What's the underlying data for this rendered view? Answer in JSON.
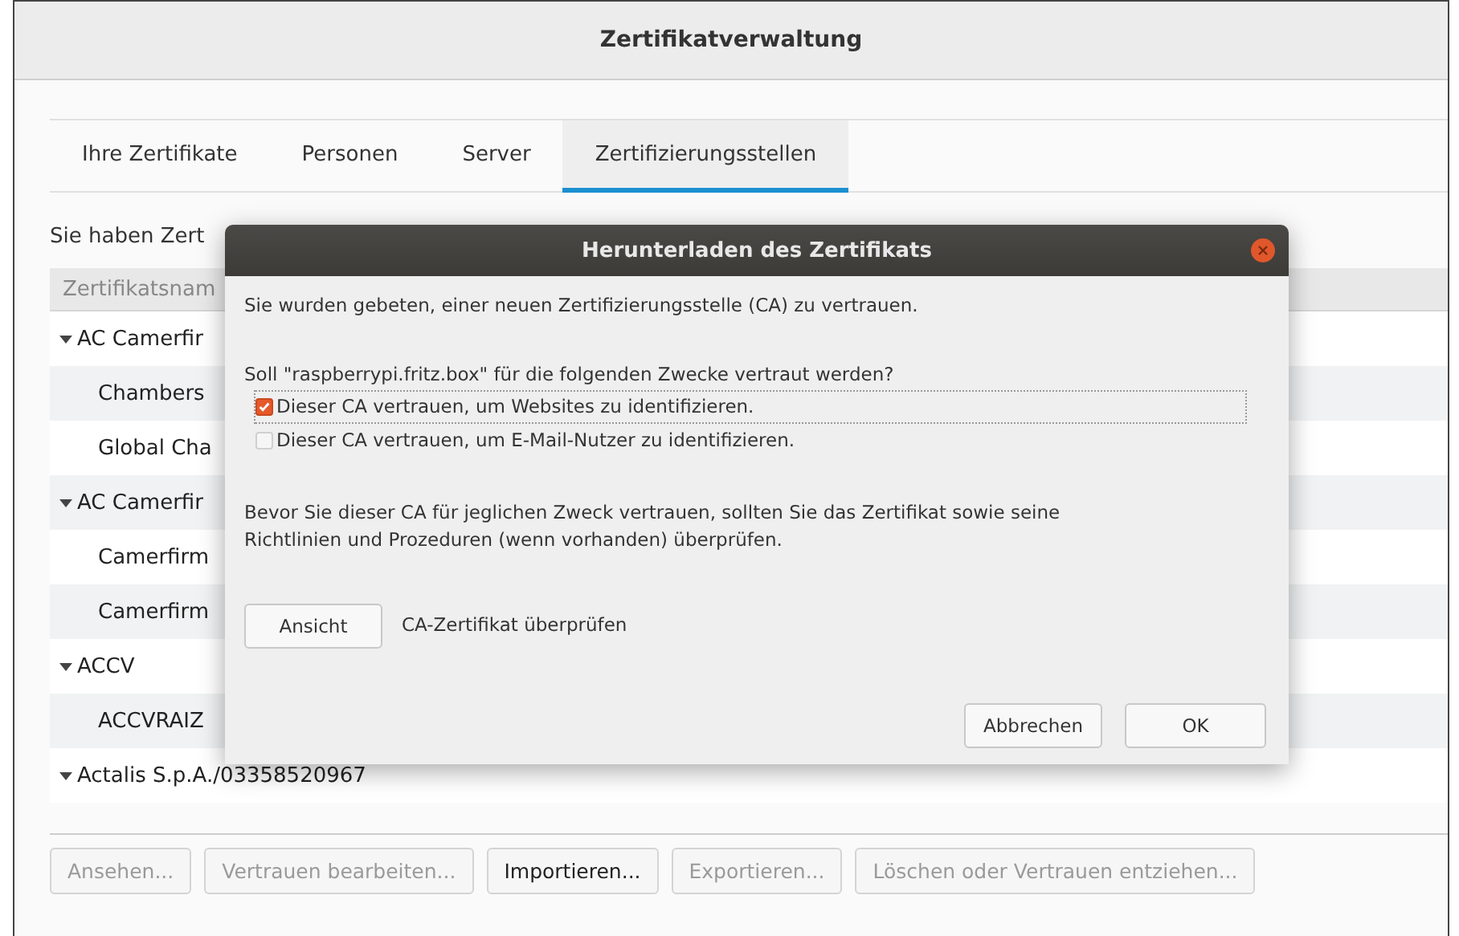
{
  "window": {
    "title": "Zertifikatverwaltung"
  },
  "tabs": [
    {
      "label": "Ihre Zertifikate",
      "selected": false
    },
    {
      "label": "Personen",
      "selected": false
    },
    {
      "label": "Server",
      "selected": false
    },
    {
      "label": "Zertifizierungsstellen",
      "selected": true
    }
  ],
  "intro": "Sie haben Zert",
  "table": {
    "columns": [
      "Zertifikatsnam"
    ],
    "rows": [
      {
        "name": "AC Camerfir",
        "expanded": true,
        "children": [
          {
            "name": "Chambers"
          },
          {
            "name": "Global Cha"
          }
        ]
      },
      {
        "name": "AC Camerfir",
        "expanded": true,
        "children": [
          {
            "name": "Camerfirm"
          },
          {
            "name": "Camerfirm"
          }
        ]
      },
      {
        "name": "ACCV",
        "expanded": true,
        "children": [
          {
            "name": "ACCVRAIZ"
          }
        ]
      },
      {
        "name": "Actalis S.p.A./03358520967",
        "expanded": true
      }
    ]
  },
  "buttons": [
    {
      "label": "Ansehen...",
      "disabled": true
    },
    {
      "label": "Vertrauen bearbeiten...",
      "disabled": true
    },
    {
      "label": "Importieren...",
      "disabled": false
    },
    {
      "label": "Exportieren...",
      "disabled": true
    },
    {
      "label": "Löschen oder Vertrauen entziehen...",
      "disabled": true
    }
  ],
  "dialog": {
    "title": "Herunterladen des Zertifikats",
    "message": "Sie wurden gebeten, einer neuen Zertifizierungsstelle (CA) zu vertrauen.",
    "question": "Soll \"raspberrypi.fritz.box\" für die folgenden Zwecke vertraut werden?",
    "purposes": [
      {
        "label": "Dieser CA vertrauen, um Websites zu identifizieren.",
        "checked": true,
        "focused": true
      },
      {
        "label": "Dieser CA vertrauen, um E-Mail-Nutzer zu identifizieren.",
        "checked": false,
        "focused": false
      }
    ],
    "advice": "Bevor Sie dieser CA für jeglichen Zweck vertrauen, sollten Sie das Zertifikat sowie seine Richtlinien und Prozeduren (wenn vorhanden) überprüfen.",
    "view_button": "Ansicht",
    "view_hint": "CA-Zertifikat überprüfen",
    "buttons": [
      "Abbrechen",
      "OK"
    ]
  }
}
